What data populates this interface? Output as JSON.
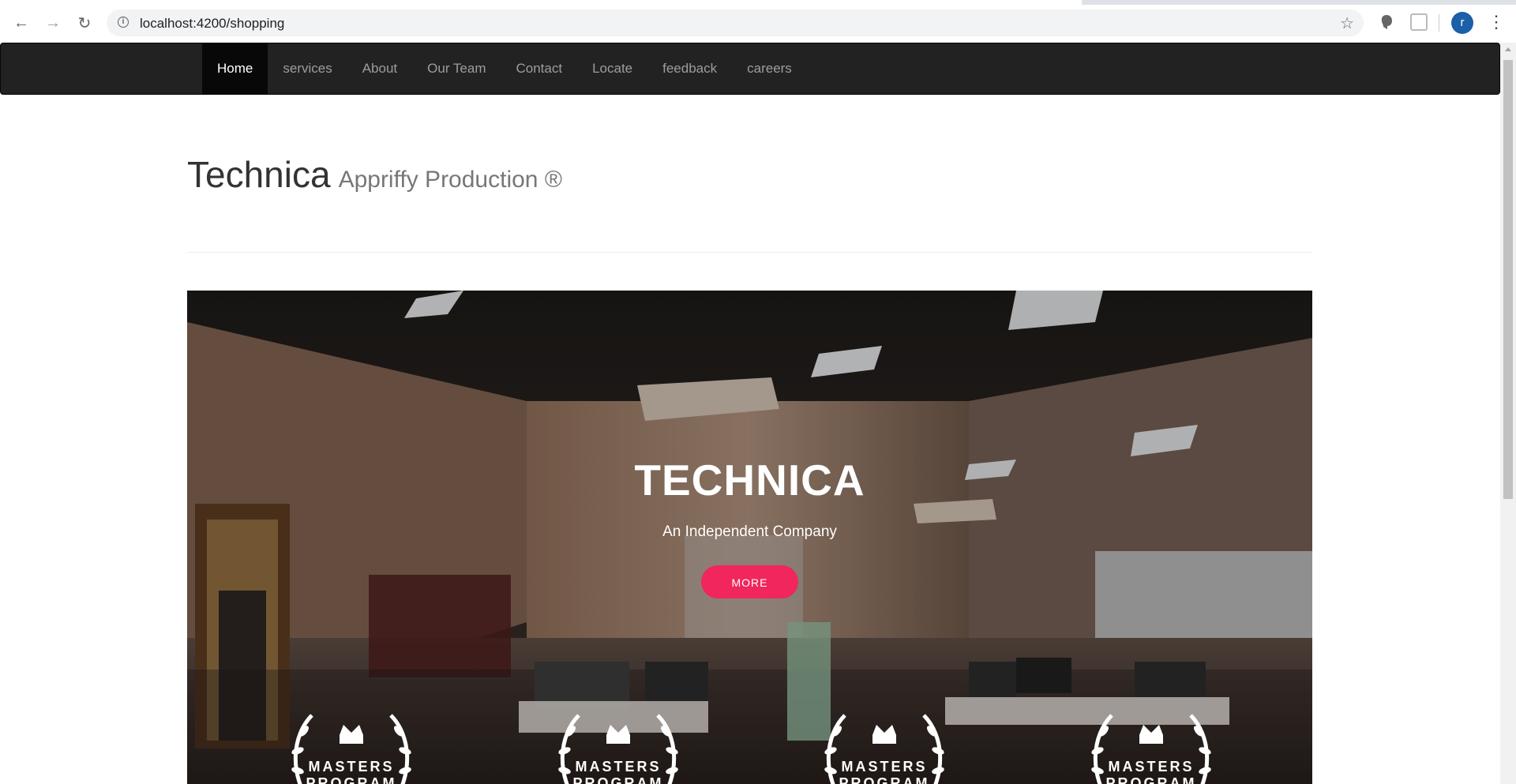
{
  "browser": {
    "url": "localhost:4200/shopping",
    "avatar_letter": "r"
  },
  "nav": {
    "items": [
      {
        "label": "Home",
        "active": true
      },
      {
        "label": "services"
      },
      {
        "label": "About"
      },
      {
        "label": "Our Team"
      },
      {
        "label": "Contact"
      },
      {
        "label": "Locate"
      },
      {
        "label": "feedback"
      },
      {
        "label": "careers"
      }
    ]
  },
  "header": {
    "title": "Technica",
    "subtitle": "Appriffy Production ®"
  },
  "hero": {
    "title": "TECHNICA",
    "subtitle": "An Independent Company",
    "button_label": "MORE",
    "button_color": "#f0265c",
    "badges": [
      {
        "line1": "MASTERS",
        "line2": "PROGRAM",
        "stars": "★★★★★"
      },
      {
        "line1": "MASTERS",
        "line2": "PROGRAM",
        "stars": "★★★★★"
      },
      {
        "line1": "MASTERS",
        "line2": "PROGRAM",
        "stars": "★★★★★"
      },
      {
        "line1": "MASTERS",
        "line2": "PROGRAM",
        "stars": "★★★★★"
      }
    ]
  }
}
